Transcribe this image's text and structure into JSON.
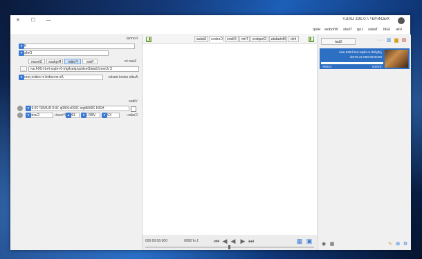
{
  "window": {
    "title": "XviD4PSP 7.0.391 DAILY"
  },
  "titlebar": {
    "close": "✕",
    "maximize": "☐",
    "minimize": "—"
  },
  "menu": [
    "File",
    "Edit",
    "Tasks",
    "Log",
    "Tools",
    "Window",
    "Help"
  ],
  "left": {
    "format_header": "Format",
    "format_value": "AVI",
    "profile_value": "Default",
    "saveto_label": "Save to:",
    "saveto_buttons": [
      "New",
      "Folder",
      "Replace",
      "Stream"
    ],
    "output_path": "C:\\Users\\Sala\\Desktop\\playfight-0-mbps-hrd-h264.avi",
    "audio_label": "Audio select tracks:",
    "audio_value": "As encoded in native preset",
    "video_header": "Video",
    "video_profile": "H264 2904kbps 1920x1080p 16:9 RUNSP 29.970",
    "codec_label": "Codec:",
    "codec_value": "XViD",
    "vbr_value": "VBR-2P",
    "bitrate_value": "1000",
    "preset_label": "Preset:",
    "preset_value": "Custom"
  },
  "tabs": [
    "Info",
    "Metadata",
    "Chapters",
    "Trim",
    "Filters",
    "Codecs",
    "Status"
  ],
  "transport": {
    "time": "000:00:00.000",
    "frame": "1 of 9000"
  },
  "right": {
    "start_label": "Start",
    "item_filename": "jellyfish-3-mbps-hrd-h264.mkv",
    "item_duration": "00:00:00.000 21.57mb",
    "item_status": "0.00%",
    "item_codec": "XVIED"
  },
  "colors": {
    "accent": "#2d6fc3",
    "spin": "#3a7bd5"
  }
}
